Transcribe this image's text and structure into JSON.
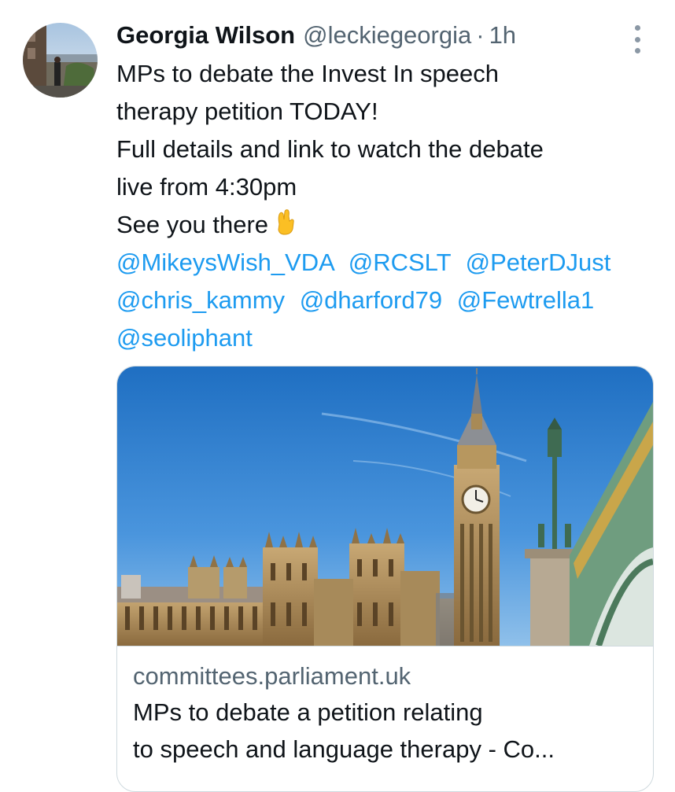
{
  "tweet": {
    "author_name": "Georgia Wilson",
    "author_handle": "@leckiegeorgia",
    "separator": "·",
    "timestamp": "1h",
    "text_lines": [
      "MPs to debate the Invest In speech",
      "therapy petition TODAY!",
      "Full details and link to watch the debate",
      "live from 4:30pm",
      "See you there"
    ],
    "emoji": "crossed-fingers-emoji",
    "mentions_line1": [
      "@MikeysWish_VDA",
      "@RCSLT",
      "@PeterDJust"
    ],
    "mentions_line2": [
      "@chris_kammy",
      "@dharford79",
      "@Fewtrella1"
    ],
    "mentions_line3": [
      "@seoliphant"
    ],
    "colors": {
      "link": "#1d9bf0",
      "muted": "#536471",
      "text": "#0f1419"
    }
  },
  "card": {
    "domain": "committees.parliament.uk",
    "title_line1": "MPs to debate a petition relating",
    "title_line2": "to speech and language therapy - Co..."
  }
}
